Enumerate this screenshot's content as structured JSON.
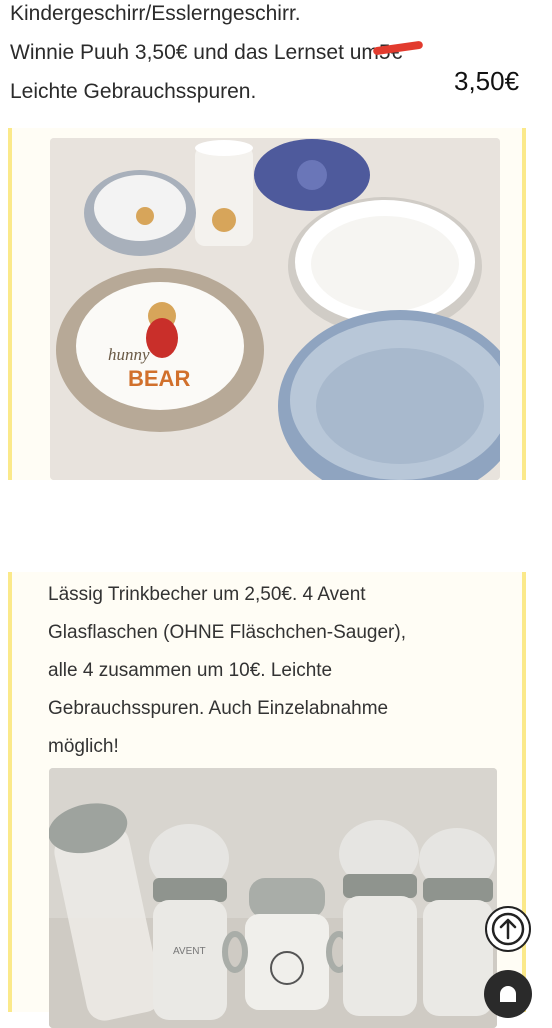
{
  "intro": {
    "line1": "Kindergeschirr/Esslerngeschirr.",
    "line2_prefix": "Winnie Puuh 3,50€ und das Lernset um",
    "line2_struck": "5€",
    "line3": "Leichte Gebrauchsspuren.",
    "handwritten_price": "3,50€"
  },
  "photo1": {
    "plate_text_1": "hunny",
    "plate_text_2": "BEAR"
  },
  "card2": {
    "lines": [
      "Lässig Trinkbecher um 2,50€. 4 Avent",
      "Glasflaschen (OHNE Fläschchen-Sauger),",
      "alle 4 zusammen um 10€. Leichte",
      "Gebrauchsspuren. Auch Einzelabnahme",
      "möglich!"
    ],
    "bottle_label": "AVENT"
  },
  "icons": {
    "scroll_top": "arrow-up-circle-icon",
    "chat": "chat-bubble-icon"
  },
  "colors": {
    "accent_border": "#fbe98a",
    "strike_red": "#e23b2e"
  }
}
